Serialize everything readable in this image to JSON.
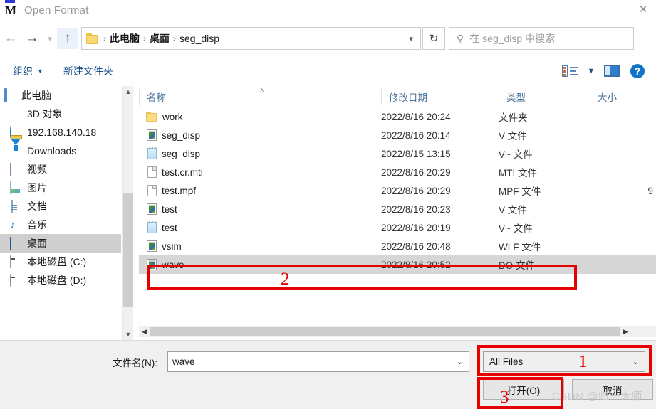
{
  "window": {
    "title": "Open Format",
    "app_icon": "modelsim-m-icon",
    "close_label": "✕"
  },
  "nav": {
    "back_icon": "arrow-left-icon",
    "forward_icon": "arrow-right-icon",
    "history_icon": "chevron-down-icon",
    "up_icon": "arrow-up-icon",
    "refresh_icon": "refresh-icon",
    "breadcrumbs": [
      "此电脑",
      "桌面",
      "seg_disp"
    ],
    "separator": "›",
    "dropdown_icon": "chevron-down-icon"
  },
  "search": {
    "icon": "search-icon",
    "placeholder": "在 seg_disp 中搜索"
  },
  "toolbar": {
    "organize_label": "组织",
    "organize_caret": "▼",
    "new_folder_label": "新建文件夹",
    "view_icon": "view-list-icon",
    "view_caret": "▼",
    "preview_pane_icon": "preview-pane-icon",
    "help_icon": "help-icon",
    "help_glyph": "?"
  },
  "sidebar": {
    "items": [
      {
        "label": "此电脑",
        "icon": "computer-icon",
        "selected": false
      },
      {
        "label": "3D 对象",
        "icon": "3d-objects-icon",
        "selected": false
      },
      {
        "label": "192.168.140.18",
        "icon": "network-icon",
        "selected": false
      },
      {
        "label": "Downloads",
        "icon": "downloads-icon",
        "selected": false
      },
      {
        "label": "视频",
        "icon": "videos-icon",
        "selected": false
      },
      {
        "label": "图片",
        "icon": "pictures-icon",
        "selected": false
      },
      {
        "label": "文档",
        "icon": "documents-icon",
        "selected": false
      },
      {
        "label": "音乐",
        "icon": "music-icon",
        "selected": false
      },
      {
        "label": "桌面",
        "icon": "desktop-icon",
        "selected": true
      },
      {
        "label": "本地磁盘 (C:)",
        "icon": "drive-icon",
        "selected": false
      },
      {
        "label": "本地磁盘 (D:)",
        "icon": "drive-icon",
        "selected": false
      }
    ],
    "scroll_up_icon": "chevron-up-icon",
    "scroll_down_icon": "chevron-down-icon"
  },
  "filelist": {
    "columns": {
      "name": "名称",
      "date": "修改日期",
      "type": "类型",
      "size": "大小"
    },
    "sort_indicator": "˄",
    "rows": [
      {
        "name": "work",
        "date": "2022/8/16 20:24",
        "type": "文件夹",
        "size": "",
        "icon": "folder-icon",
        "selected": false
      },
      {
        "name": "seg_disp",
        "date": "2022/8/16 20:14",
        "type": "V 文件",
        "size": "",
        "icon": "verilog-file-icon",
        "selected": false
      },
      {
        "name": "seg_disp",
        "date": "2022/8/15 13:15",
        "type": "V~ 文件",
        "size": "",
        "icon": "notepad-file-icon",
        "selected": false
      },
      {
        "name": "test.cr.mti",
        "date": "2022/8/16 20:29",
        "type": "MTI 文件",
        "size": "",
        "icon": "generic-file-icon",
        "selected": false
      },
      {
        "name": "test.mpf",
        "date": "2022/8/16 20:29",
        "type": "MPF 文件",
        "size": "9",
        "icon": "generic-file-icon",
        "selected": false
      },
      {
        "name": "test",
        "date": "2022/8/16 20:23",
        "type": "V 文件",
        "size": "",
        "icon": "verilog-file-icon",
        "selected": false
      },
      {
        "name": "test",
        "date": "2022/8/16 20:19",
        "type": "V~ 文件",
        "size": "",
        "icon": "notepad-file-icon",
        "selected": false
      },
      {
        "name": "vsim",
        "date": "2022/8/16 20:48",
        "type": "WLF 文件",
        "size": "",
        "icon": "verilog-file-icon",
        "selected": false
      },
      {
        "name": "wave",
        "date": "2022/8/16 20:52",
        "type": "DO 文件",
        "size": "",
        "icon": "verilog-file-icon",
        "selected": true
      }
    ],
    "hscroll_left_icon": "chevron-left-icon",
    "hscroll_right_icon": "chevron-right-icon"
  },
  "bottom": {
    "filename_label": "文件名(N):",
    "filename_value": "wave",
    "filename_caret": "⌄",
    "filter_value": "All Files",
    "filter_caret": "⌄",
    "open_button": "打开(O)",
    "cancel_button": "取消"
  },
  "annotations": {
    "color": "#e60000",
    "markers": [
      {
        "id": "1",
        "target": "file-type-filter"
      },
      {
        "id": "2",
        "target": "wave-file-row"
      },
      {
        "id": "3",
        "target": "open-button"
      }
    ]
  },
  "watermark": "CSDN @归一大师"
}
